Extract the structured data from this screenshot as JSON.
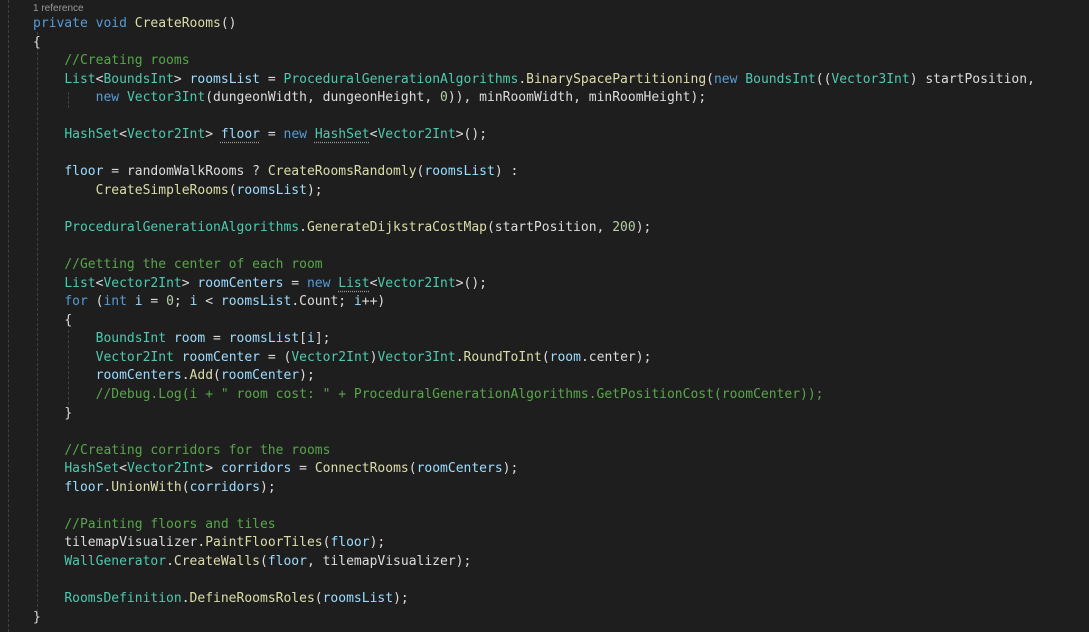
{
  "codelens": "1 reference",
  "colors": {
    "background": "#1e1e1e",
    "keyword": "#569cd6",
    "type": "#4ec9b0",
    "method": "#dcdcaa",
    "variable": "#9cdcfe",
    "number": "#b5cea8",
    "string": "#d69d85",
    "comment": "#57a64a",
    "plain": "#dcdcdc"
  },
  "lines": [
    {
      "indent": 0,
      "tokens": [
        [
          "kw",
          "private"
        ],
        [
          "p",
          " "
        ],
        [
          "kw",
          "void"
        ],
        [
          "p",
          " "
        ],
        [
          "fn",
          "CreateRooms"
        ],
        [
          "p",
          "()"
        ]
      ]
    },
    {
      "indent": 0,
      "tokens": [
        [
          "p",
          "{"
        ]
      ]
    },
    {
      "indent": 4,
      "tokens": [
        [
          "cmt",
          "//Creating rooms"
        ]
      ]
    },
    {
      "indent": 4,
      "tokens": [
        [
          "type",
          "List"
        ],
        [
          "p",
          "<"
        ],
        [
          "type",
          "BoundsInt"
        ],
        [
          "p",
          "> "
        ],
        [
          "var",
          "roomsList"
        ],
        [
          "p",
          " = "
        ],
        [
          "type",
          "ProceduralGenerationAlgorithms"
        ],
        [
          "p",
          "."
        ],
        [
          "fn",
          "BinarySpacePartitioning"
        ],
        [
          "p",
          "("
        ],
        [
          "kw",
          "new"
        ],
        [
          "p",
          " "
        ],
        [
          "type",
          "BoundsInt"
        ],
        [
          "p",
          "(("
        ],
        [
          "type",
          "Vector3Int"
        ],
        [
          "p",
          ") startPosition,"
        ]
      ]
    },
    {
      "indent": 8,
      "tokens": [
        [
          "kw",
          "new"
        ],
        [
          "p",
          " "
        ],
        [
          "type",
          "Vector3Int"
        ],
        [
          "p",
          "(dungeonWidth, dungeonHeight, "
        ],
        [
          "num",
          "0"
        ],
        [
          "p",
          ")), minRoomWidth, minRoomHeight);"
        ]
      ]
    },
    {
      "indent": 0,
      "tokens": []
    },
    {
      "indent": 4,
      "tokens": [
        [
          "type",
          "HashSet"
        ],
        [
          "p",
          "<"
        ],
        [
          "type",
          "Vector2Int"
        ],
        [
          "p",
          "> "
        ],
        [
          "var_dots",
          "floor"
        ],
        [
          "p",
          " = "
        ],
        [
          "kw",
          "new"
        ],
        [
          "p",
          " "
        ],
        [
          "type_dots",
          "HashSet"
        ],
        [
          "p",
          "<"
        ],
        [
          "type",
          "Vector2Int"
        ],
        [
          "p",
          ">();"
        ]
      ]
    },
    {
      "indent": 0,
      "tokens": []
    },
    {
      "indent": 4,
      "tokens": [
        [
          "var",
          "floor"
        ],
        [
          "p",
          " = randomWalkRooms ? "
        ],
        [
          "fn",
          "CreateRoomsRandomly"
        ],
        [
          "p",
          "("
        ],
        [
          "var",
          "roomsList"
        ],
        [
          "p",
          ") :"
        ]
      ]
    },
    {
      "indent": 8,
      "tokens": [
        [
          "fn",
          "CreateSimpleRooms"
        ],
        [
          "p",
          "("
        ],
        [
          "var",
          "roomsList"
        ],
        [
          "p",
          ");"
        ]
      ]
    },
    {
      "indent": 0,
      "tokens": []
    },
    {
      "indent": 4,
      "tokens": [
        [
          "type",
          "ProceduralGenerationAlgorithms"
        ],
        [
          "p",
          "."
        ],
        [
          "fn",
          "GenerateDijkstraCostMap"
        ],
        [
          "p",
          "(startPosition, "
        ],
        [
          "num",
          "200"
        ],
        [
          "p",
          ");"
        ]
      ]
    },
    {
      "indent": 0,
      "tokens": []
    },
    {
      "indent": 4,
      "tokens": [
        [
          "cmt",
          "//Getting the center of each room"
        ]
      ]
    },
    {
      "indent": 4,
      "tokens": [
        [
          "type",
          "List"
        ],
        [
          "p",
          "<"
        ],
        [
          "type",
          "Vector2Int"
        ],
        [
          "p",
          "> "
        ],
        [
          "var",
          "roomCenters"
        ],
        [
          "p",
          " = "
        ],
        [
          "kw",
          "new"
        ],
        [
          "p",
          " "
        ],
        [
          "type_dots",
          "List"
        ],
        [
          "p",
          "<"
        ],
        [
          "type",
          "Vector2Int"
        ],
        [
          "p",
          ">();"
        ]
      ]
    },
    {
      "indent": 4,
      "tokens": [
        [
          "kw",
          "for"
        ],
        [
          "p",
          " ("
        ],
        [
          "kw",
          "int"
        ],
        [
          "p",
          " "
        ],
        [
          "var",
          "i"
        ],
        [
          "p",
          " = "
        ],
        [
          "num",
          "0"
        ],
        [
          "p",
          "; "
        ],
        [
          "var",
          "i"
        ],
        [
          "p",
          " < "
        ],
        [
          "var",
          "roomsList"
        ],
        [
          "p",
          ".Count; "
        ],
        [
          "var",
          "i"
        ],
        [
          "p",
          "++)"
        ]
      ]
    },
    {
      "indent": 4,
      "tokens": [
        [
          "p",
          "{"
        ]
      ]
    },
    {
      "indent": 8,
      "tokens": [
        [
          "type",
          "BoundsInt"
        ],
        [
          "p",
          " "
        ],
        [
          "var",
          "room"
        ],
        [
          "p",
          " = "
        ],
        [
          "var",
          "roomsList"
        ],
        [
          "p",
          "["
        ],
        [
          "var",
          "i"
        ],
        [
          "p",
          "];"
        ]
      ]
    },
    {
      "indent": 8,
      "tokens": [
        [
          "type",
          "Vector2Int"
        ],
        [
          "p",
          " "
        ],
        [
          "var",
          "roomCenter"
        ],
        [
          "p",
          " = ("
        ],
        [
          "type",
          "Vector2Int"
        ],
        [
          "p",
          ")"
        ],
        [
          "type",
          "Vector3Int"
        ],
        [
          "p",
          "."
        ],
        [
          "fn",
          "RoundToInt"
        ],
        [
          "p",
          "("
        ],
        [
          "var",
          "room"
        ],
        [
          "p",
          ".center);"
        ]
      ]
    },
    {
      "indent": 8,
      "tokens": [
        [
          "var",
          "roomCenters"
        ],
        [
          "p",
          "."
        ],
        [
          "fn",
          "Add"
        ],
        [
          "p",
          "("
        ],
        [
          "var",
          "roomCenter"
        ],
        [
          "p",
          ");"
        ]
      ]
    },
    {
      "indent": 8,
      "tokens": [
        [
          "cmt",
          "//Debug.Log(i + \" room cost: \" + ProceduralGenerationAlgorithms.GetPositionCost(roomCenter));"
        ]
      ]
    },
    {
      "indent": 4,
      "tokens": [
        [
          "p",
          "}"
        ]
      ]
    },
    {
      "indent": 0,
      "tokens": []
    },
    {
      "indent": 4,
      "tokens": [
        [
          "cmt",
          "//Creating corridors for the rooms"
        ]
      ]
    },
    {
      "indent": 4,
      "tokens": [
        [
          "type",
          "HashSet"
        ],
        [
          "p",
          "<"
        ],
        [
          "type",
          "Vector2Int"
        ],
        [
          "p",
          "> "
        ],
        [
          "var",
          "corridors"
        ],
        [
          "p",
          " = "
        ],
        [
          "fn",
          "ConnectRooms"
        ],
        [
          "p",
          "("
        ],
        [
          "var",
          "roomCenters"
        ],
        [
          "p",
          ");"
        ]
      ]
    },
    {
      "indent": 4,
      "tokens": [
        [
          "var",
          "floor"
        ],
        [
          "p",
          "."
        ],
        [
          "fn",
          "UnionWith"
        ],
        [
          "p",
          "("
        ],
        [
          "var",
          "corridors"
        ],
        [
          "p",
          ");"
        ]
      ]
    },
    {
      "indent": 0,
      "tokens": []
    },
    {
      "indent": 4,
      "tokens": [
        [
          "cmt",
          "//Painting floors and tiles"
        ]
      ]
    },
    {
      "indent": 4,
      "tokens": [
        [
          "p",
          "tilemapVisualizer."
        ],
        [
          "fn",
          "PaintFloorTiles"
        ],
        [
          "p",
          "("
        ],
        [
          "var",
          "floor"
        ],
        [
          "p",
          ");"
        ]
      ]
    },
    {
      "indent": 4,
      "tokens": [
        [
          "type",
          "WallGenerator"
        ],
        [
          "p",
          "."
        ],
        [
          "fn",
          "CreateWalls"
        ],
        [
          "p",
          "("
        ],
        [
          "var",
          "floor"
        ],
        [
          "p",
          ", tilemapVisualizer);"
        ]
      ]
    },
    {
      "indent": 0,
      "tokens": []
    },
    {
      "indent": 4,
      "tokens": [
        [
          "type",
          "RoomsDefinition"
        ],
        [
          "p",
          "."
        ],
        [
          "fn",
          "DefineRoomsRoles"
        ],
        [
          "p",
          "("
        ],
        [
          "var",
          "roomsList"
        ],
        [
          "p",
          ");"
        ]
      ]
    },
    {
      "indent": 0,
      "tokens": [
        [
          "p",
          "}"
        ]
      ]
    }
  ]
}
